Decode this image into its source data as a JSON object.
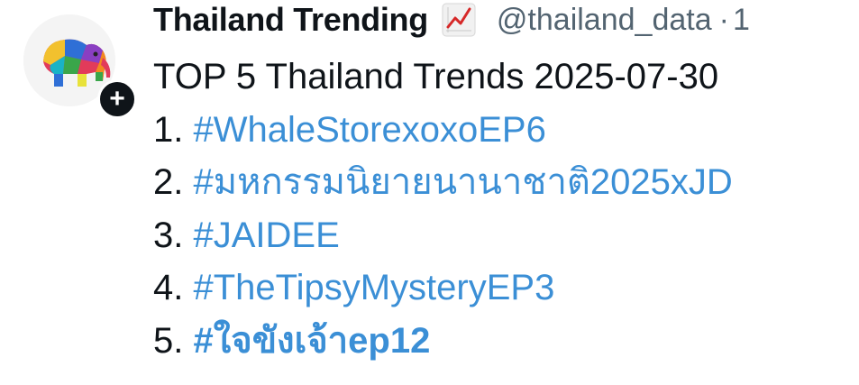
{
  "profile": {
    "display_name": "Thailand Trending",
    "badge_icon": "chart-increasing-icon",
    "handle": "@thailand_data",
    "separator": "·",
    "time": "1",
    "avatar_icon": "colorful-elephant-logo",
    "follow_icon": "plus-icon"
  },
  "tweet": {
    "headline": "TOP 5 Thailand Trends 2025-07-30",
    "trends": [
      {
        "rank": "1.",
        "tag": "#WhaleStorexoxoEP6",
        "bold": false
      },
      {
        "rank": "2.",
        "tag": "#มหกรรมนิยายนานาชาติ2025xJD",
        "bold": false
      },
      {
        "rank": "3.",
        "tag": "#JAIDEE",
        "bold": false
      },
      {
        "rank": "4.",
        "tag": "#TheTipsyMysteryEP3",
        "bold": false
      },
      {
        "rank": "5.",
        "tag": "#ใจขังเจ้าep12",
        "bold": true
      }
    ]
  },
  "colors": {
    "text": "#0f1419",
    "secondary": "#536471",
    "hashtag": "#3b8fd6",
    "background": "#ffffff"
  }
}
